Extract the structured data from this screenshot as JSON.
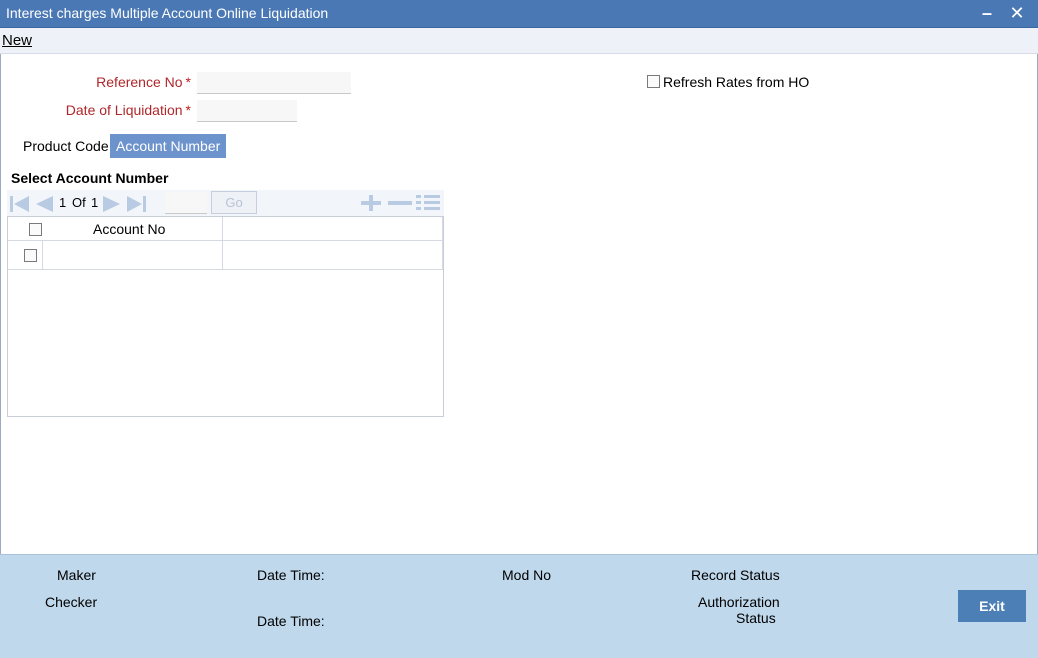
{
  "window": {
    "title": "Interest charges Multiple Account Online Liquidation",
    "minimize_icon": "minimize-icon",
    "close_icon": "close-icon"
  },
  "menu": {
    "new_label": "New"
  },
  "form": {
    "reference_no": {
      "label": "Reference No",
      "required_mark": "*",
      "value": ""
    },
    "date_of_liquidation": {
      "label": "Date of Liquidation",
      "required_mark": "*",
      "value": ""
    },
    "refresh_rates": {
      "label": "Refresh Rates from HO",
      "checked": false
    }
  },
  "tabs": [
    {
      "label": "Product Code",
      "active": false
    },
    {
      "label": "Account Number",
      "active": true
    }
  ],
  "account_grid": {
    "section_title": "Select Account Number",
    "pager": {
      "current": "1",
      "of_label": "Of",
      "total": "1",
      "go_label": "Go"
    },
    "columns": [
      "Account No"
    ],
    "rows": [
      {
        "account_no": ""
      }
    ]
  },
  "footer": {
    "maker_label": "Maker",
    "checker_label": "Checker",
    "date_time_label": "Date Time:",
    "mod_no_label": "Mod No",
    "record_status_label": "Record Status",
    "authorization_label": "Authorization",
    "status_label": "Status",
    "exit_label": "Exit"
  },
  "colors": {
    "title_bar": "#4a78b5",
    "active_tab": "#6d93cc",
    "footer_bg": "#bfd8ec",
    "exit_button": "#4d7fb7",
    "required_label": "#b0272b"
  }
}
